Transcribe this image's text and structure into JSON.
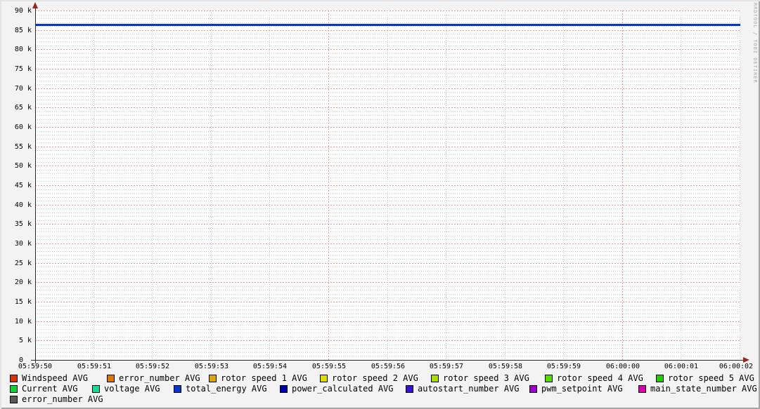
{
  "watermark": "RRDTOOL / TOBI OETIKER",
  "chart_data": {
    "type": "line",
    "title": "",
    "x_axis": {
      "tick_labels": [
        "05:59:50",
        "05:59:51",
        "05:59:52",
        "05:59:53",
        "05:59:54",
        "05:59:55",
        "05:59:56",
        "05:59:57",
        "05:59:58",
        "05:59:59",
        "06:00:00",
        "06:00:01",
        "06:00:02"
      ],
      "major_tick_indices": [
        5,
        10
      ],
      "range_seconds": 12
    },
    "y_axis": {
      "min": 0,
      "max": 90000,
      "major_step": 5000,
      "minor_step": 1000,
      "tick_labels": [
        "0",
        "5 k",
        "10 k",
        "15 k",
        "20 k",
        "25 k",
        "30 k",
        "35 k",
        "40 k",
        "45 k",
        "50 k",
        "55 k",
        "60 k",
        "65 k",
        "70 k",
        "75 k",
        "80 k",
        "85 k",
        "90 k"
      ]
    },
    "grid": {
      "minor_color": "#cccccc",
      "major_color": "#ec9b9b",
      "axis_color": "#2a2a2a",
      "arrow_color": "#96261f",
      "plot_bg": "#ffffff",
      "canvas_bg": "#f3f3f3"
    },
    "plotted_line": {
      "series": "total_energy AVG",
      "shape": "constant horizontal line",
      "value": 86400,
      "color": "#0734cc"
    },
    "series": [
      {
        "name": "Windspeed AVG",
        "color": "#d93400",
        "visible_value": null
      },
      {
        "name": "error_number AVG",
        "color": "#dd7700",
        "visible_value": null
      },
      {
        "name": "rotor speed 1 AVG",
        "color": "#dda600",
        "visible_value": null
      },
      {
        "name": "rotor speed 2 AVG",
        "color": "#dddd00",
        "visible_value": null
      },
      {
        "name": "rotor speed 3 AVG",
        "color": "#aadd00",
        "visible_value": null
      },
      {
        "name": "rotor speed 4 AVG",
        "color": "#55dd00",
        "visible_value": null
      },
      {
        "name": "rotor speed 5 AVG",
        "color": "#22cc00",
        "visible_value": null
      },
      {
        "name": "Current AVG",
        "color": "#11d034",
        "visible_value": null
      },
      {
        "name": "voltage AVG",
        "color": "#11dd99",
        "visible_value": null
      },
      {
        "name": "total_energy AVG",
        "color": "#0734cc",
        "visible_value": 86400
      },
      {
        "name": "power_calculated AVG",
        "color": "#0000aa",
        "visible_value": null
      },
      {
        "name": "autostart_number AVG",
        "color": "#3713cf",
        "visible_value": null
      },
      {
        "name": "pwm_setpoint AVG",
        "color": "#9900cc",
        "visible_value": null
      },
      {
        "name": "main_state_number AVG",
        "color": "#dd00aa",
        "visible_value": null
      },
      {
        "name": "error_number AVG",
        "color": "#595959",
        "visible_value": null
      }
    ],
    "legend_rows": [
      [
        0,
        1,
        2,
        3,
        4,
        5,
        6
      ],
      [
        7,
        8,
        9,
        10,
        11,
        12,
        13
      ],
      [
        14
      ]
    ]
  }
}
